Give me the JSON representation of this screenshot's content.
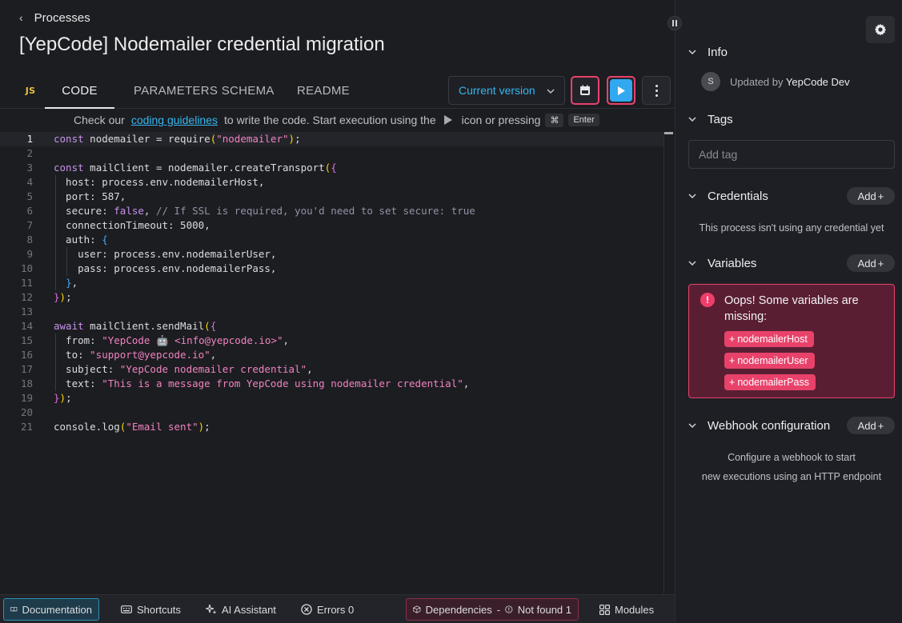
{
  "header": {
    "back_label": "Processes",
    "title": "[YepCode] Nodemailer credential migration"
  },
  "tabs": {
    "lang_badge": "JS",
    "items": [
      "CODE",
      "PARAMETERS SCHEMA",
      "README"
    ],
    "active": "CODE"
  },
  "toolbar": {
    "version_label": "Current version"
  },
  "hint": {
    "prefix": "Check our",
    "link": "coding guidelines",
    "middle": "to write the code. Start execution using the",
    "suffix": "icon or pressing",
    "key_cmd": "⌘",
    "key_enter": "Enter"
  },
  "editor": {
    "current_line": 1,
    "lines": [
      "const nodemailer = require(\"nodemailer\");",
      "",
      "const mailClient = nodemailer.createTransport({",
      "  host: process.env.nodemailerHost,",
      "  port: 587,",
      "  secure: false, // If SSL is required, you'd need to set secure: true",
      "  connectionTimeout: 5000,",
      "  auth: {",
      "    user: process.env.nodemailerUser,",
      "    pass: process.env.nodemailerPass,",
      "  },",
      "});",
      "",
      "await mailClient.sendMail({",
      "  from: \"YepCode 🤖 <info@yepcode.io>\",",
      "  to: \"support@yepcode.io\",",
      "  subject: \"YepCode nodemailer credential\",",
      "  text: \"This is a message from YepCode using nodemailer credential\",",
      "});",
      "",
      "console.log(\"Email sent\");"
    ]
  },
  "bottombar": {
    "documentation": "Documentation",
    "shortcuts": "Shortcuts",
    "ai_assistant": "AI Assistant",
    "errors": "Errors 0",
    "dependencies": "Dependencies",
    "dep_separator": "-",
    "not_found": "Not found 1",
    "modules": "Modules"
  },
  "sidebar": {
    "info": {
      "title": "Info",
      "avatar_initial": "S",
      "updated_prefix": "Updated by",
      "updated_by": "YepCode Dev"
    },
    "tags": {
      "title": "Tags",
      "placeholder": "Add tag"
    },
    "credentials": {
      "title": "Credentials",
      "add_label": "Add",
      "empty_text": "This process isn't using any credential yet"
    },
    "variables": {
      "title": "Variables",
      "add_label": "Add",
      "warning": "Oops! Some variables are missing:",
      "missing": [
        "nodemailerHost",
        "nodemailerUser",
        "nodemailerPass"
      ]
    },
    "webhook": {
      "title": "Webhook configuration",
      "add_label": "Add",
      "line1": "Configure a webhook to start",
      "line2": "new executions using an HTTP endpoint"
    }
  },
  "colors": {
    "accent": "#35b6f0",
    "danger": "#e8426b",
    "run_button": "#31a8ef"
  }
}
